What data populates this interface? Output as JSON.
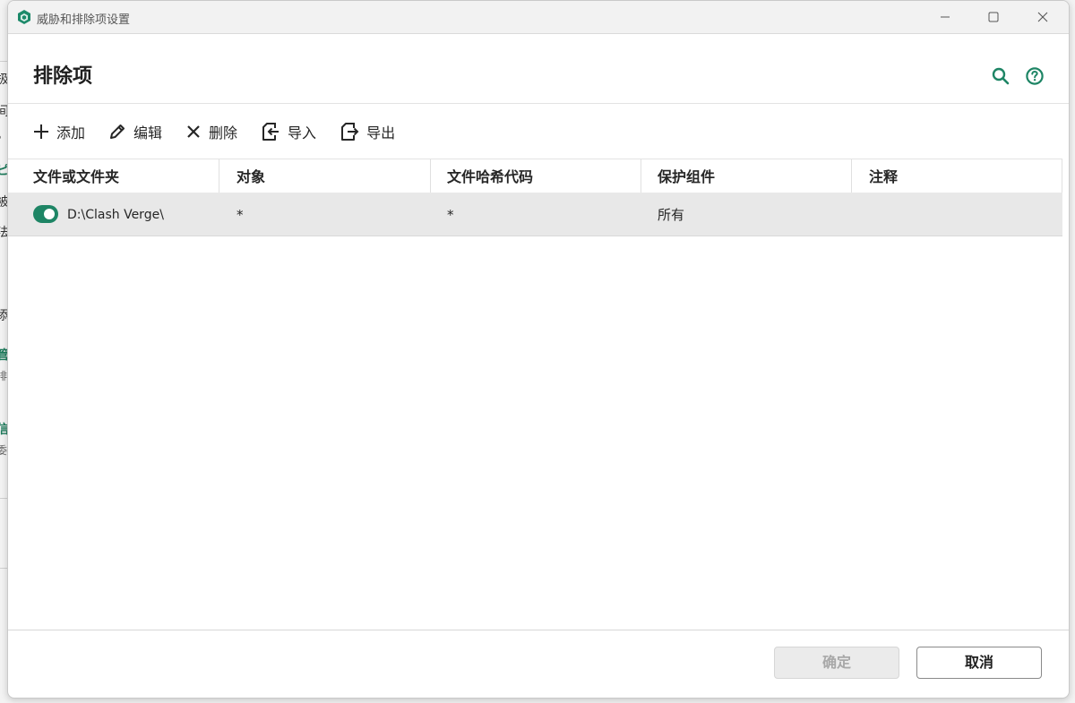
{
  "window": {
    "title": "威胁和排除项设置",
    "controls": [
      "minimize-icon",
      "maximize-icon",
      "close-icon"
    ]
  },
  "page": {
    "title": "排除项",
    "header_icons": [
      "search-icon",
      "help-icon"
    ]
  },
  "toolbar": {
    "add_label": "添加",
    "edit_label": "编辑",
    "delete_label": "删除",
    "import_label": "导入",
    "export_label": "导出"
  },
  "table": {
    "columns": [
      "文件或文件夹",
      "对象",
      "文件哈希代码",
      "保护组件",
      "注释"
    ],
    "rows": [
      {
        "enabled": true,
        "path": "D:\\Clash Verge\\",
        "object": "*",
        "hash": "*",
        "component": "所有",
        "comment": ""
      }
    ]
  },
  "footer": {
    "ok_label": "确定",
    "cancel_label": "取消"
  },
  "background": {
    "fragments": [
      "扱",
      "间",
      "，",
      "ピ",
      "被",
      "法",
      "添",
      "管",
      "排",
      "信",
      "委"
    ]
  },
  "colors": {
    "accent": "#1e8565",
    "row_selected": "#e8e8e8",
    "disabled_text": "#a8a8a8"
  }
}
